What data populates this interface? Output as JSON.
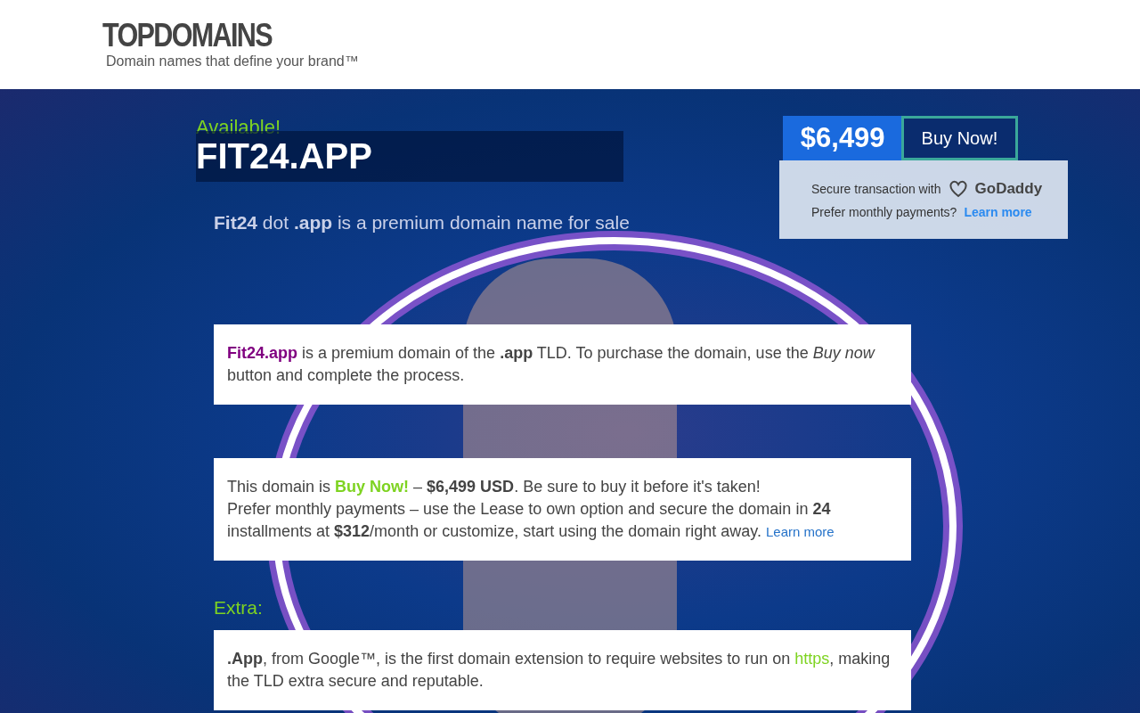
{
  "header": {
    "logo": "TOPDOMAINS",
    "tagline": "Domain names that define your brand™"
  },
  "hero": {
    "status": "Available!",
    "domain": "FIT24.APP",
    "subtitle": [
      {
        "kind": "bold",
        "text": "Fit24"
      },
      {
        "kind": "text",
        "text": " dot "
      },
      {
        "kind": "bold",
        "text": ".app"
      },
      {
        "kind": "text",
        "text": " is a premium domain name for sale"
      }
    ]
  },
  "purchase": {
    "price": "$6,499",
    "button": "Buy Now!",
    "secure_text": "Secure transaction with",
    "partner": "GoDaddy",
    "monthly_text": "Prefer monthly payments?",
    "monthly_link": "Learn more"
  },
  "cards": [
    {
      "paragraphs": [
        [
          {
            "kind": "brand",
            "text": "Fit24.app"
          },
          {
            "kind": "text",
            "text": " is a premium domain of the "
          },
          {
            "kind": "bold",
            "text": ".app"
          },
          {
            "kind": "text",
            "text": " TLD. To purchase the domain, use the "
          },
          {
            "kind": "italic",
            "text": "Buy now"
          },
          {
            "kind": "text",
            "text": " button and complete the process."
          }
        ]
      ]
    },
    {
      "paragraphs": [
        [
          {
            "kind": "text",
            "text": "This domain is "
          },
          {
            "kind": "accent",
            "text": "Buy Now!"
          },
          {
            "kind": "text",
            "text": " – "
          },
          {
            "kind": "bold",
            "text": "$6,499 USD"
          },
          {
            "kind": "text",
            "text": ". Be sure to buy it before it's taken!"
          }
        ],
        [
          {
            "kind": "text",
            "text": "Prefer monthly payments – use the Lease to own option and secure the domain in "
          },
          {
            "kind": "bold",
            "text": "24"
          },
          {
            "kind": "text",
            "text": " installments at "
          },
          {
            "kind": "bold",
            "text": "$312"
          },
          {
            "kind": "text",
            "text": "/month or customize, start using the domain right away. "
          },
          {
            "kind": "link",
            "text": "Learn more"
          }
        ]
      ]
    }
  ],
  "extra": {
    "heading": "Extra:",
    "paragraphs": [
      [
        {
          "kind": "bold",
          "text": ".App"
        },
        {
          "kind": "text",
          "text": ", from Google™, is the first domain extension to require websites to run on "
        },
        {
          "kind": "accent",
          "text": "https"
        },
        {
          "kind": "text",
          "text": ", making the TLD extra secure and reputable."
        }
      ]
    ]
  }
}
